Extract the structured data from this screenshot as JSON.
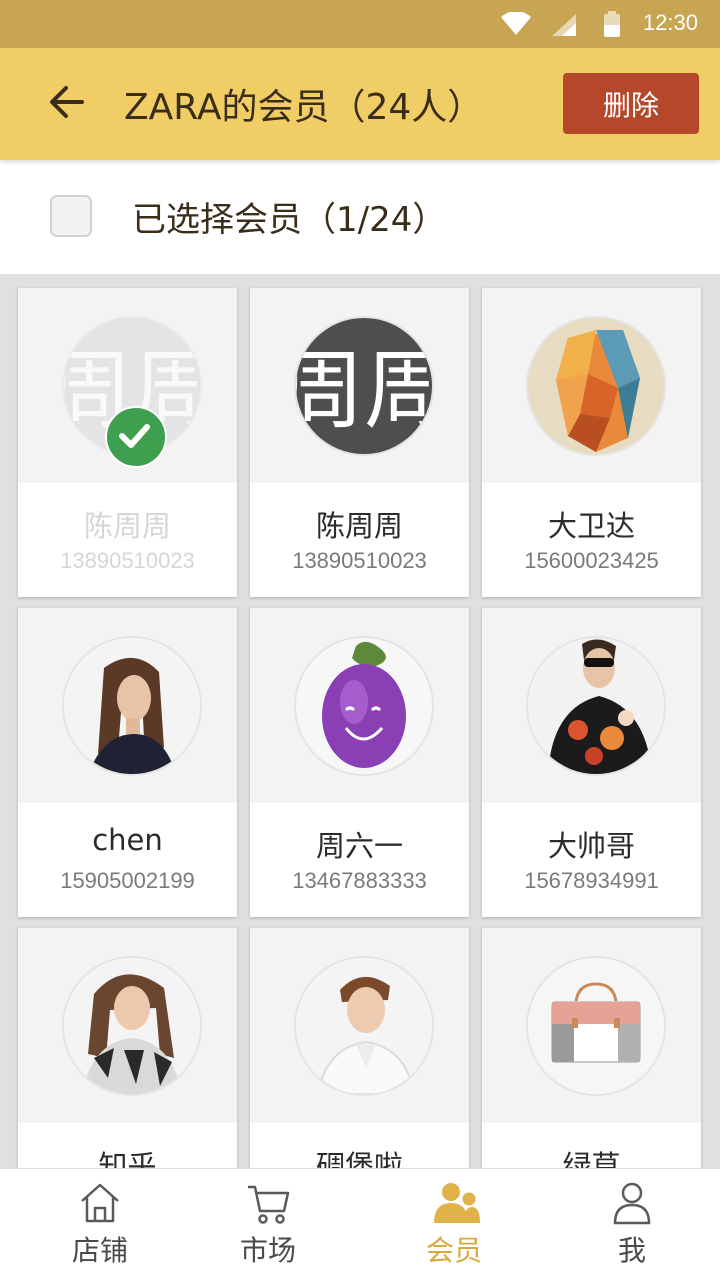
{
  "status_bar": {
    "time": "12:30"
  },
  "app_bar": {
    "title": "ZARA的会员（24人）",
    "delete_label": "删除"
  },
  "selection": {
    "label": "已选择会员（1/24）"
  },
  "members": [
    {
      "name": "陈周周",
      "phone": "13890510023",
      "selected": true,
      "avatar": "text-avatar"
    },
    {
      "name": "陈周周",
      "phone": "13890510023",
      "selected": false,
      "avatar": "text-avatar"
    },
    {
      "name": "大卫达",
      "phone": "15600023425",
      "selected": false,
      "avatar": "polygon-face"
    },
    {
      "name": "chen",
      "phone": "15905002199",
      "selected": false,
      "avatar": "woman-portrait"
    },
    {
      "name": "周六一",
      "phone": "13467883333",
      "selected": false,
      "avatar": "eggplant"
    },
    {
      "name": "大帅哥",
      "phone": "15678934991",
      "selected": false,
      "avatar": "man-sunglasses"
    },
    {
      "name": "知乎",
      "phone": "",
      "selected": false,
      "avatar": "woman-pattern"
    },
    {
      "name": "碉堡啦",
      "phone": "",
      "selected": false,
      "avatar": "man-portrait"
    },
    {
      "name": "绿草",
      "phone": "",
      "selected": false,
      "avatar": "handbag"
    }
  ],
  "avatar_text": "周周",
  "tabs": [
    {
      "label": "店铺",
      "icon": "shop-icon",
      "active": false
    },
    {
      "label": "市场",
      "icon": "cart-icon",
      "active": false
    },
    {
      "label": "会员",
      "icon": "members-icon",
      "active": true
    },
    {
      "label": "我",
      "icon": "person-icon",
      "active": false
    }
  ],
  "colors": {
    "status_bar": "#c7a552",
    "app_bar": "#f1cd66",
    "delete_button": "#b5472a",
    "check": "#3ea04e",
    "active_tab": "#d9a93c"
  }
}
